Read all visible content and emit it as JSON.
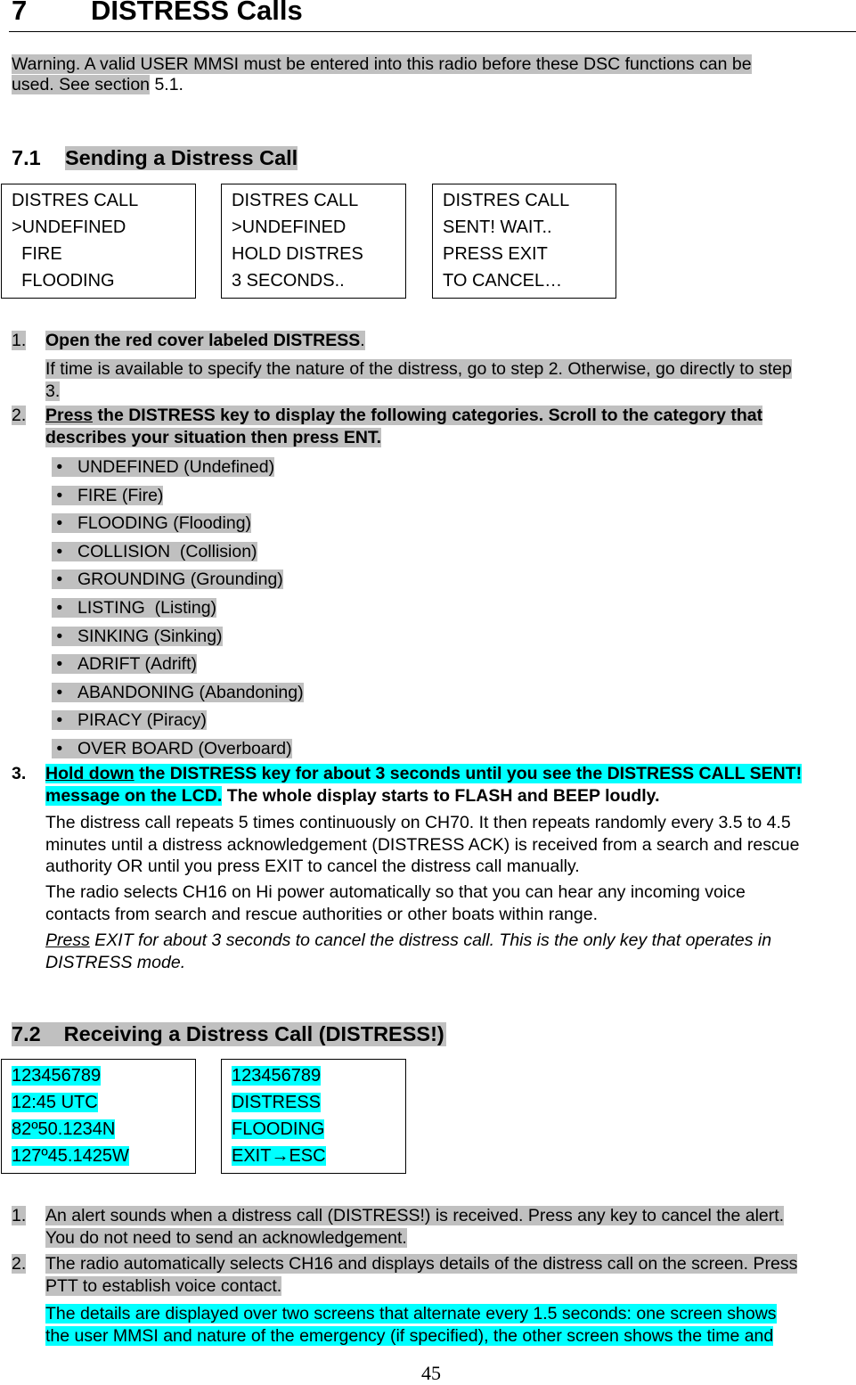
{
  "chapter": {
    "number": "7",
    "title": "DISTRESS Calls"
  },
  "warning": {
    "line1": "Warning. A valid USER MMSI must be entered into this radio before these DSC functions can be",
    "line2_hl": "used. See section",
    "line2_rest": " 5.1."
  },
  "section1": {
    "number": "7.1",
    "title": "Sending a Distress Call",
    "screens": [
      [
        "DISTRES CALL",
        ">UNDEFINED",
        "  FIRE",
        "  FLOODING"
      ],
      [
        "DISTRES CALL",
        ">UNDEFINED",
        "HOLD DISTRES",
        "3 SECONDS.."
      ],
      [
        "DISTRES CALL",
        "SENT! WAIT..",
        "PRESS EXIT",
        "TO CANCEL…"
      ]
    ],
    "step1": {
      "num": "1.",
      "text": "Open the red cover labeled DISTRESS",
      "end": ".",
      "note1": "If time is available to specify the nature of the distress, go to step 2. Otherwise, go directly to step",
      "note2": "3."
    },
    "step2": {
      "num": "2.",
      "u": "Press",
      "text1": " the DISTRESS key to display the following categories. Scroll to the category that",
      "text2": "describes your situation then press ENT."
    },
    "categories": [
      "UNDEFINED (Undefined)",
      "FIRE (Fire)",
      "FLOODING (Flooding)",
      "COLLISION  (Collision)",
      "GROUNDING (Grounding)",
      "LISTING  (Listing)",
      "SINKING (Sinking)",
      "ADRIFT (Adrift)",
      "ABANDONING (Abandoning)",
      "PIRACY (Piracy)",
      "OVER BOARD (Overboard)"
    ],
    "step3": {
      "num": "3.",
      "u": "Hold down",
      "text1": " the DISTRESS key for about 3 seconds until you see the DISTRESS CALL SENT!",
      "text2_hl": "message on the LCD.",
      "text2_rest": " The whole display starts to FLASH and BEEP loudly.",
      "p1": [
        "The distress call repeats 5 times continuously on CH70. It then repeats randomly every 3.5 to 4.5",
        "minutes until a distress acknowledgement (DISTRESS ACK) is received from a search and rescue",
        "authority OR until you press EXIT to cancel the distress call manually."
      ],
      "p2": [
        "The radio selects CH16 on Hi power automatically so that you can hear any incoming voice",
        "contacts from search and rescue authorities or other boats within range."
      ],
      "p3_u": "Press",
      "p3_1": " EXIT for about 3 seconds to cancel the distress call. This is the only key that operates in",
      "p3_2": "DISTRESS mode."
    }
  },
  "section2": {
    "number": "7.2",
    "title": "Receiving a Distress Call (DISTRESS!)",
    "screens": [
      [
        "123456789",
        "12:45 UTC",
        "82º50.1234N",
        "127º45.1425W"
      ],
      [
        "123456789",
        "DISTRESS",
        "FLOODING",
        "EXIT→ESC"
      ]
    ],
    "step1": {
      "num": "1.",
      "l1": "An alert sounds when a distress call (DISTRESS!) is received. Press any key to cancel the alert.",
      "l2": "You do not need to send an acknowledgement."
    },
    "step2": {
      "num": "2.",
      "l1": "The radio automatically selects CH16 and displays details of the distress call on the screen. Press",
      "l2": "PTT to establish voice contact."
    },
    "note": [
      "The details are displayed over two screens that alternate every 1.5 seconds: one screen shows",
      "the user MMSI and nature of the emergency (if specified), the other screen shows the time and"
    ]
  },
  "page_number": "45",
  "colors": {
    "highlight_gray": "#c0c0c0",
    "highlight_cyan": "#00ffff"
  }
}
